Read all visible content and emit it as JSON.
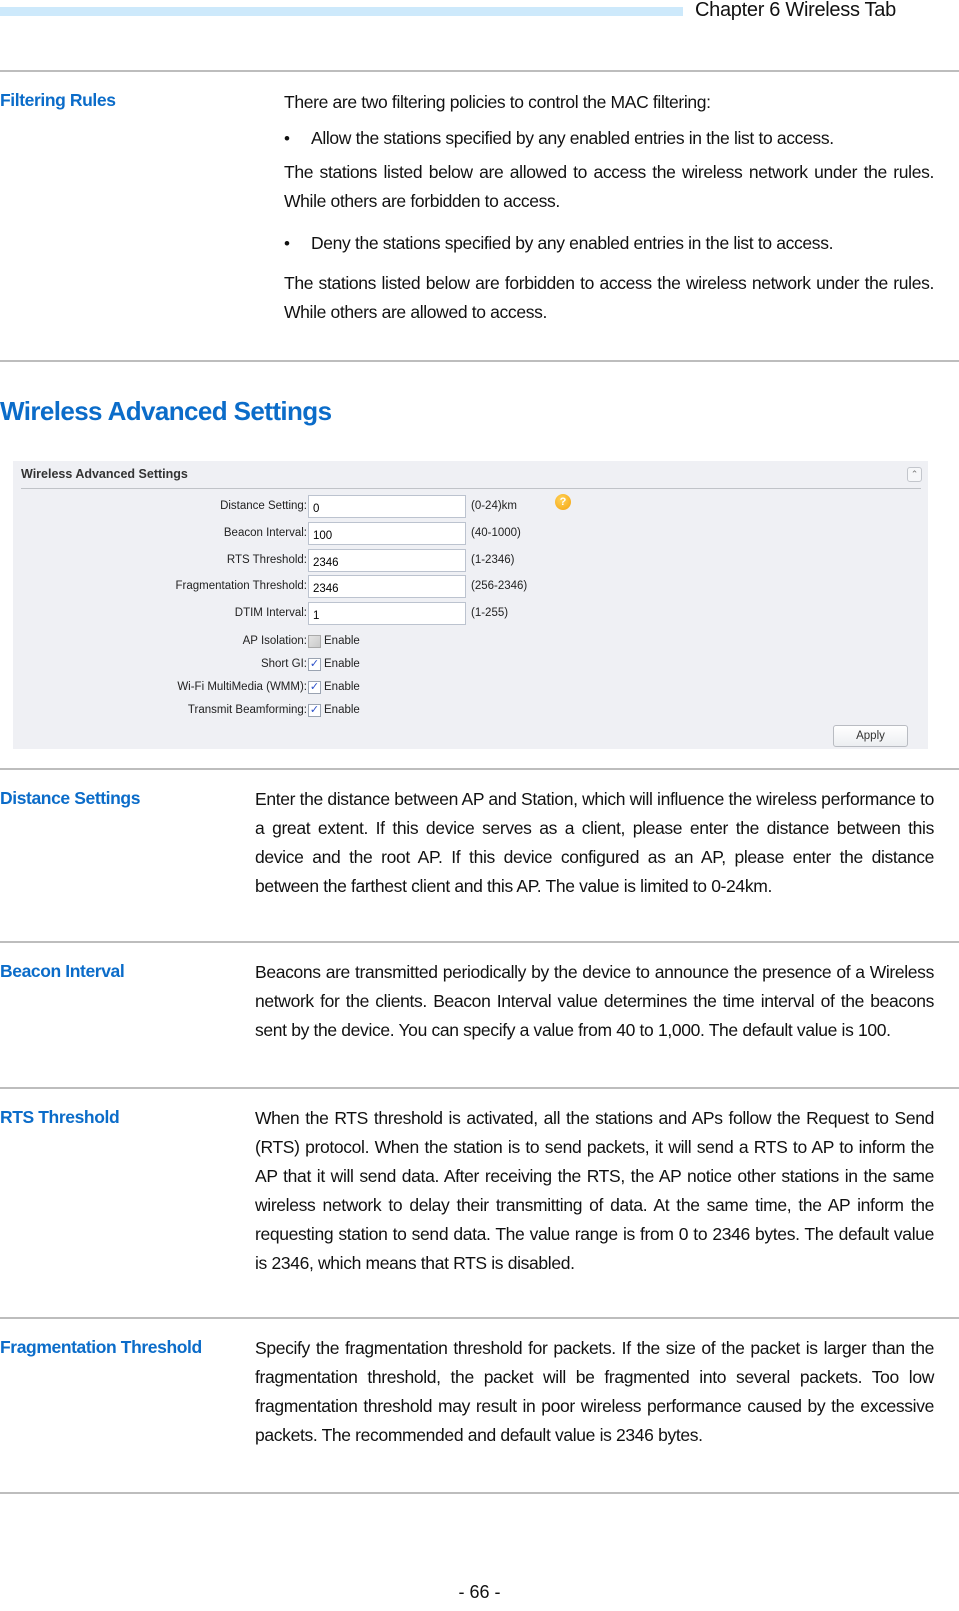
{
  "header": {
    "chapter_title": "Chapter 6 Wireless Tab"
  },
  "filtering_rules": {
    "term": "Filtering Rules",
    "intro": "There are two filtering policies to control the MAC filtering:",
    "policies": [
      {
        "bullet": "Allow the stations specified by any enabled entries in the list to access.",
        "explanation": "The stations listed below are allowed to access the wireless network under the rules. While others are forbidden to access."
      },
      {
        "bullet": "Deny the stations specified by any enabled entries in the list to access.",
        "explanation": "The stations listed below are forbidden to access the wireless network under the rules. While others are allowed to access."
      }
    ]
  },
  "section_title": "Wireless Advanced Settings",
  "panel": {
    "title": "Wireless Advanced Settings",
    "collapse_icon": "double-chevron-up",
    "fields": [
      {
        "label": "Distance Setting:",
        "value": "0",
        "hint": "(0-24)km",
        "help_icon": "question-icon"
      },
      {
        "label": "Beacon Interval:",
        "value": "100",
        "hint": "(40-1000)"
      },
      {
        "label": "RTS Threshold:",
        "value": "2346",
        "hint": "(1-2346)"
      },
      {
        "label": "Fragmentation Threshold:",
        "value": "2346",
        "hint": "(256-2346)"
      },
      {
        "label": "DTIM Interval:",
        "value": "1",
        "hint": "(1-255)"
      }
    ],
    "checkboxes": [
      {
        "label": "AP Isolation:",
        "option": "Enable",
        "checked": false
      },
      {
        "label": "Short GI:",
        "option": "Enable",
        "checked": true
      },
      {
        "label": "Wi-Fi MultiMedia (WMM):",
        "option": "Enable",
        "checked": true
      },
      {
        "label": "Transmit Beamforming:",
        "option": "Enable",
        "checked": true
      }
    ],
    "apply_label": "Apply"
  },
  "definitions": [
    {
      "term": "Distance Settings",
      "text": "Enter the distance between AP and Station, which will influence the wireless performance to a great extent. If this device serves as a client, please enter the distance between this device and the root AP. If this device configured as an AP, please enter the distance between the farthest client and this AP. The value is limited to 0-24km."
    },
    {
      "term": "Beacon Interval",
      "text": "Beacons are transmitted periodically by the device to announce the presence of a Wireless network for the clients. Beacon Interval value determines the time interval of the beacons sent by the device. You can specify a value from 40 to 1,000. The default value is 100."
    },
    {
      "term": "RTS Threshold",
      "text": "When the RTS threshold is activated, all the stations and APs follow the Request to Send (RTS) protocol. When the station is to send packets, it will send a RTS to AP to inform the AP that it will send data. After receiving the RTS, the AP notice other stations in the same wireless network to delay their transmitting of data. At the same time, the AP inform the requesting station to send data. The value range is from 0 to 2346 bytes. The default value is 2346, which means that RTS is disabled."
    },
    {
      "term": "Fragmentation Threshold",
      "text": "Specify the fragmentation threshold for packets. If the size of the packet is larger than the fragmentation threshold, the packet will be fragmented into several packets. Too low fragmentation threshold may result in poor wireless performance caused by the excessive packets. The recommended and default value is 2346 bytes."
    }
  ],
  "footer": {
    "page_number": "- 66 -"
  },
  "colors": {
    "accent_blue": "#0b6cc9",
    "header_bar": "#cde9fb",
    "rule_gray": "#bdbdbd",
    "panel_bg": "#eff0f4"
  }
}
